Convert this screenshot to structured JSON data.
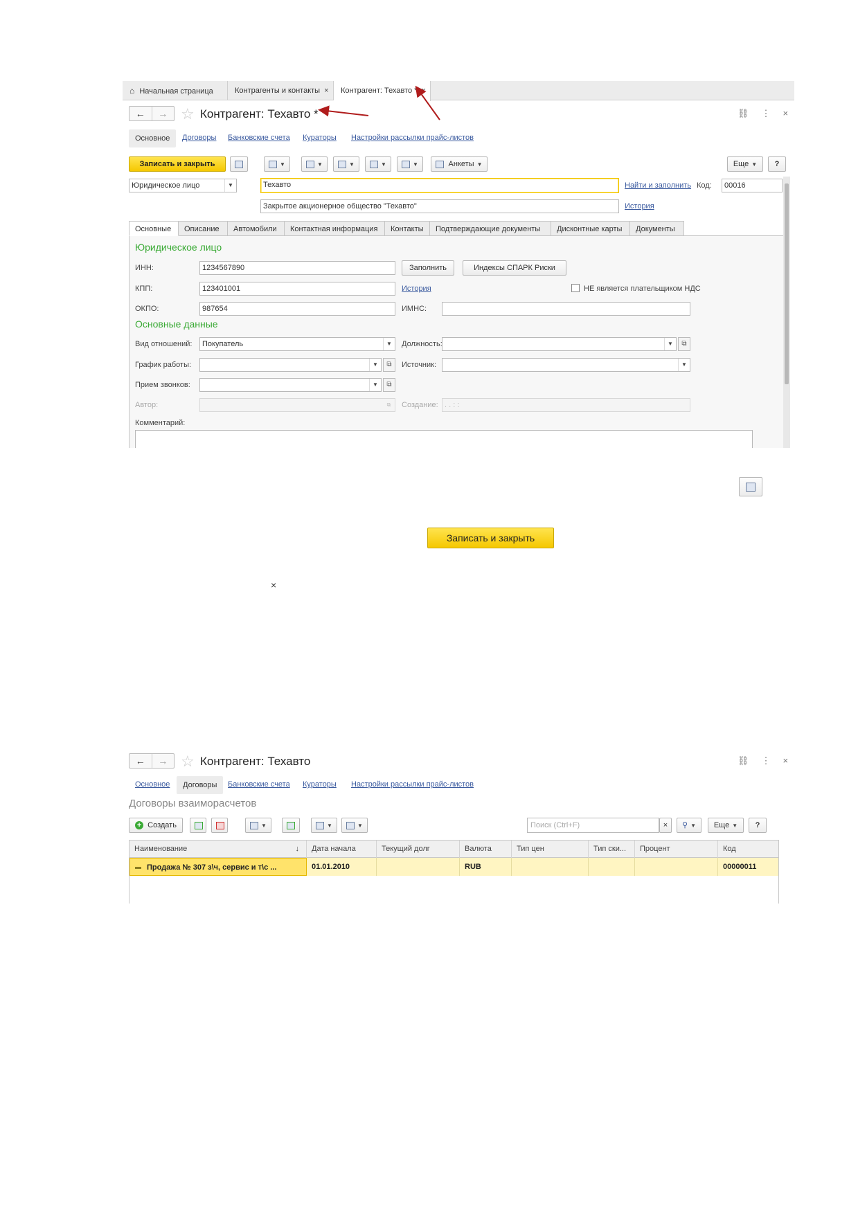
{
  "window1": {
    "tabs": [
      "Начальная страница",
      "Контрагенты и контакты",
      "Контрагент: Техавто *"
    ],
    "tab_close": "×",
    "title": "Контрагент: Техавто *",
    "nav_back": "←",
    "nav_forward": "→",
    "star": "☆",
    "window_icons": [
      "link-icon",
      "more-icon",
      "close-icon"
    ],
    "window_glyphs": [
      "⛓",
      "⋮",
      "×"
    ],
    "section_tabs": [
      "Основное",
      "Договоры",
      "Банковские счета",
      "Кураторы",
      "Настройки рассылки прайс-листов"
    ],
    "toolbar": {
      "save_close": "Записать и закрыть",
      "surveys": "Анкеты",
      "more": "Еще",
      "help": "?"
    },
    "legal_type": "Юридическое лицо",
    "name_value": "Техавто",
    "find_fill": "Найти и заполнить",
    "code_label": "Код:",
    "code_value": "00016",
    "full_name_value": "Закрытое акционерное общество \"Техавто\"",
    "history_link": "История",
    "inner_tabs": [
      "Основные",
      "Описание",
      "Автомобили",
      "Контактная информация",
      "Контакты",
      "Подтверждающие документы",
      "Дисконтные карты",
      "Документы"
    ],
    "section_legal": "Юридическое лицо",
    "inn_label": "ИНН:",
    "inn_value": "1234567890",
    "fill_button": "Заполнить",
    "spark_button": "Индексы СПАРК Риски",
    "kpp_label": "КПП:",
    "kpp_value": "123401001",
    "kpp_history": "История",
    "vat_checkbox": "НЕ является плательщиком НДС",
    "okpo_label": "ОКПО:",
    "okpo_value": "987654",
    "imns_label": "ИМНС:",
    "imns_value": "",
    "section_main": "Основные данные",
    "relation_label": "Вид отношений:",
    "relation_value": "Покупатель",
    "position_label": "Должность:",
    "schedule_label": "График работы:",
    "source_label": "Источник:",
    "calls_label": "Прием звонков:",
    "author_label": "Автор:",
    "created_label": "Создание:",
    "created_value": ". .     : :",
    "comment_label": "Комментарий:"
  },
  "floating": {
    "save_close_large": "Записать и закрыть",
    "close_glyph": "×"
  },
  "window2": {
    "title": "Контрагент: Техавто",
    "nav_back": "←",
    "nav_forward": "→",
    "star": "☆",
    "window_glyphs": [
      "⛓",
      "⋮",
      "×"
    ],
    "section_tabs": [
      "Основное",
      "Договоры",
      "Банковские счета",
      "Кураторы",
      "Настройки рассылки прайс-листов"
    ],
    "list_title": "Договоры взаиморасчетов",
    "create_button": "Создать",
    "search_placeholder": "Поиск (Ctrl+F)",
    "search_clear": "×",
    "more": "Еще",
    "help": "?",
    "columns": [
      "Наименование",
      "Дата начала",
      "Текущий долг",
      "Валюта",
      "Тип цен",
      "Тип ски...",
      "Процент",
      "Код"
    ],
    "sort_glyph": "↓",
    "rows": [
      {
        "name": "Продажа № 307 з\\ч, сервис и т\\с ...",
        "start": "01.01.2010",
        "debt": "",
        "currency": "RUB",
        "price_type": "",
        "discount_type": "",
        "percent": "",
        "code": "00000011"
      }
    ]
  },
  "colors": {
    "accent_yellow": "#f5c800",
    "link_blue": "#3a5a9f",
    "section_green": "#3aaa35",
    "annotation_red": "#b01c1c"
  }
}
